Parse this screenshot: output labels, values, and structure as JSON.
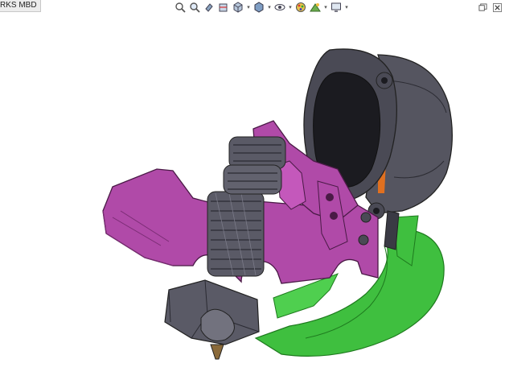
{
  "document": {
    "tab_label": "RKS MBD"
  },
  "toolbar": {
    "icons": [
      "zoom-to-fit-icon",
      "zoom-to-area-icon",
      "previous-view-icon",
      "section-view-icon",
      "view-orientation-icon",
      "display-style-icon",
      "hide-show-items-icon",
      "edit-appearance-icon",
      "apply-scene-icon",
      "view-settings-icon"
    ]
  },
  "window_controls": {
    "icons": [
      "restore-window-icon",
      "close-window-icon"
    ]
  },
  "model": {
    "colors": {
      "background": "#ffffff",
      "housing": "#4a4a55",
      "housing_dark": "#2c2c33",
      "frame_magenta": "#b04aa8",
      "frame_magenta_dark": "#7a2c74",
      "shroud_green": "#3fbf3f",
      "shroud_green_dark": "#1e7a1e",
      "heater_block": "#5a5a66",
      "orange_accent": "#e07020"
    }
  }
}
